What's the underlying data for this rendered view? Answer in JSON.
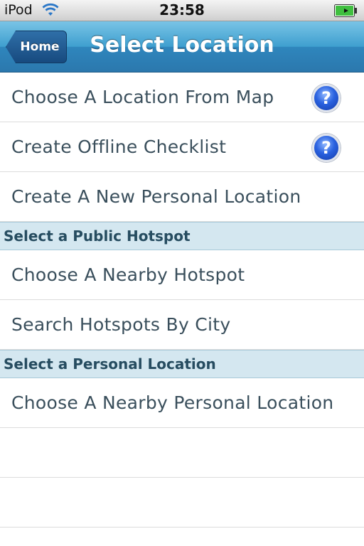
{
  "status_bar": {
    "carrier": "iPod",
    "time": "23:58",
    "wifi_icon": "wifi-icon",
    "battery_icon": "battery-charging-icon"
  },
  "nav": {
    "back_label": "Home",
    "title": "Select Location"
  },
  "rows_top": [
    {
      "label": "Choose A Location From Map",
      "help_icon": "help-icon",
      "help_glyph": "?"
    },
    {
      "label": "Create Offline Checklist",
      "help_icon": "help-icon",
      "help_glyph": "?"
    },
    {
      "label": "Create A New Personal Location"
    }
  ],
  "sections": [
    {
      "header": "Select a Public Hotspot",
      "rows": [
        "Choose A Nearby Hotspot",
        "Search Hotspots By City"
      ]
    },
    {
      "header": "Select a Personal Location",
      "rows": [
        "Choose A Nearby Personal Location"
      ]
    }
  ],
  "colors": {
    "nav_bar": "#3f9fcf",
    "section_header_bg": "#d4e7f0",
    "row_text": "#3a4f5c",
    "help_icon": "#2a62e0"
  }
}
